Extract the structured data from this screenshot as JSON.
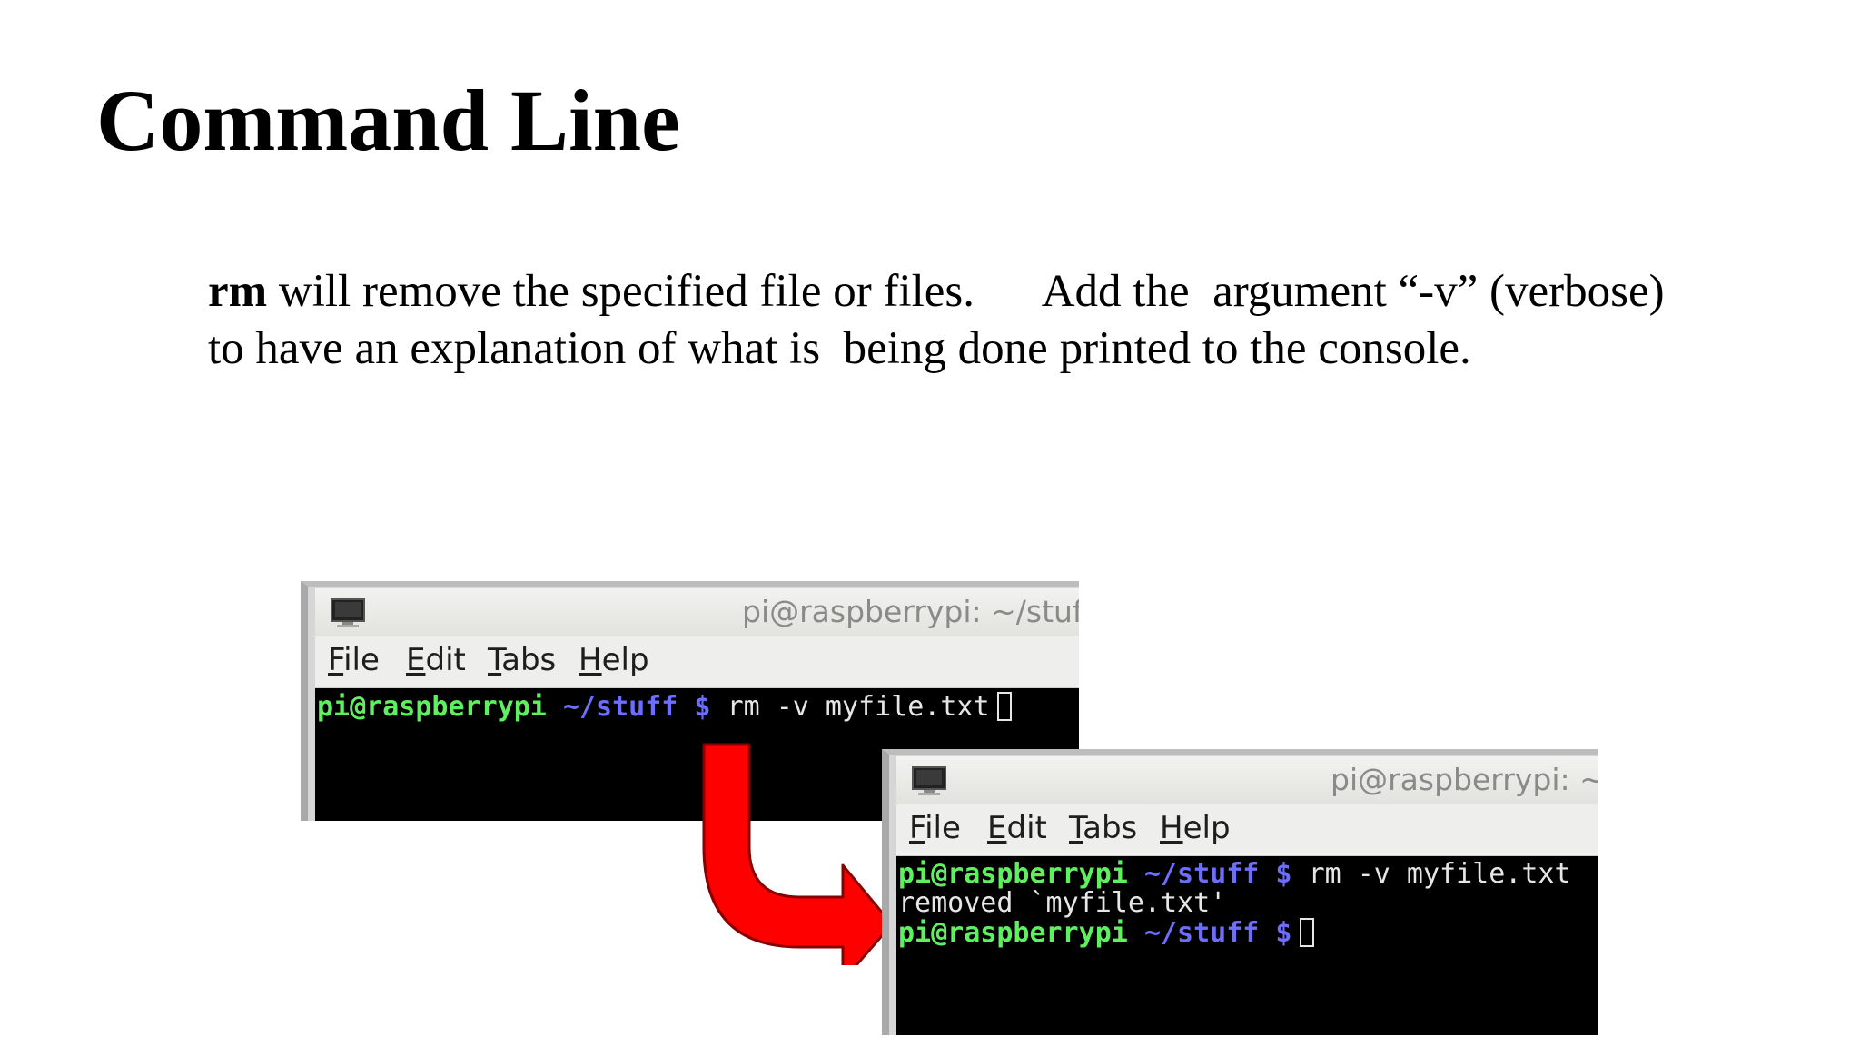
{
  "slide": {
    "title": "Command Line",
    "body_line1_cmd": "rm",
    "body_line1_rest": " will remove the specified file or files.      Add the  argument “-v” (verbose)",
    "body_line2": "to have an explanation of what is  being done printed to the console."
  },
  "terminal1": {
    "title": "pi@raspberrypi: ~/stuff",
    "menu": {
      "file_u": "F",
      "file_rest": "ile",
      "edit_u": "E",
      "edit_rest": "dit",
      "tabs_u": "T",
      "tabs_rest": "abs",
      "help_u": "H",
      "help_rest": "elp"
    },
    "prompt_user": "pi@raspberrypi",
    "prompt_path": "~/stuff $",
    "command": "rm -v myfile.txt"
  },
  "terminal2": {
    "title": "pi@raspberrypi: ~/s",
    "menu": {
      "file_u": "F",
      "file_rest": "ile",
      "edit_u": "E",
      "edit_rest": "dit",
      "tabs_u": "T",
      "tabs_rest": "abs",
      "help_u": "H",
      "help_rest": "elp"
    },
    "prompt_user": "pi@raspberrypi",
    "prompt_path": "~/stuff $",
    "command": "rm -v myfile.txt",
    "output": "removed `myfile.txt'"
  },
  "colors": {
    "prompt_user": "#5ef05e",
    "prompt_path": "#6d6dff",
    "arrow": "#ff0000"
  },
  "icons": {
    "terminal_icon": "monitor-icon",
    "arrow": "red-bent-arrow-icon"
  }
}
